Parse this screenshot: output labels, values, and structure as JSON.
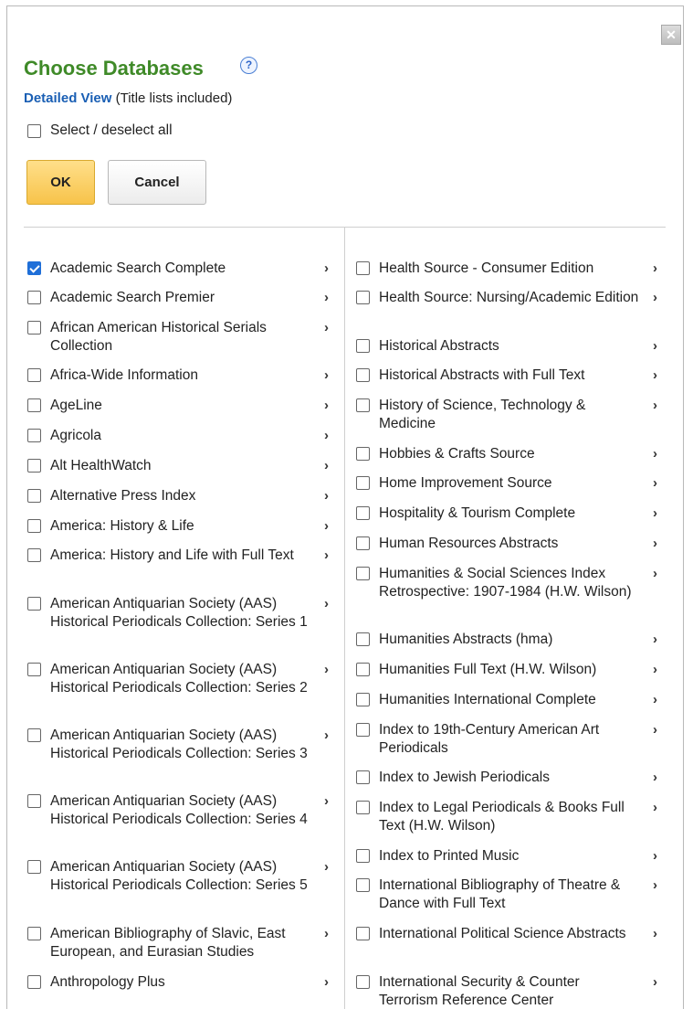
{
  "dialog": {
    "close_label": "✕",
    "title": "Choose Databases",
    "help_label": "?",
    "detailed_link": "Detailed View",
    "detailed_note": " (Title lists included)",
    "select_all_label": "Select / deselect all",
    "ok_label": "OK",
    "cancel_label": "Cancel",
    "chevron": "›"
  },
  "left_list": [
    {
      "label": "Academic Search Complete",
      "checked": true
    },
    {
      "label": "Academic Search Premier",
      "checked": false
    },
    {
      "label": "African American Historical Serials Collection",
      "checked": false
    },
    {
      "label": "Africa-Wide Information",
      "checked": false
    },
    {
      "label": "AgeLine",
      "checked": false
    },
    {
      "label": "Agricola",
      "checked": false
    },
    {
      "label": "Alt HealthWatch",
      "checked": false
    },
    {
      "label": "Alternative Press Index",
      "checked": false
    },
    {
      "label": "America: History & Life",
      "checked": false
    },
    {
      "label": "America: History and Life with Full Text",
      "checked": false
    },
    {
      "label": "American Antiquarian Society (AAS) Historical Periodicals Collection: Series 1",
      "checked": false
    },
    {
      "label": "American Antiquarian Society (AAS) Historical Periodicals Collection: Series 2",
      "checked": false
    },
    {
      "label": "American Antiquarian Society (AAS) Historical Periodicals Collection: Series 3",
      "checked": false
    },
    {
      "label": "American Antiquarian Society (AAS) Historical Periodicals Collection: Series 4",
      "checked": false
    },
    {
      "label": "American Antiquarian Society (AAS) Historical Periodicals Collection: Series 5",
      "checked": false
    },
    {
      "label": "American Bibliography of Slavic, East European, and Eurasian Studies",
      "checked": false
    },
    {
      "label": "Anthropology Plus",
      "checked": false
    }
  ],
  "right_list": [
    {
      "label": "Health Source - Consumer Edition",
      "checked": false
    },
    {
      "label": "Health Source: Nursing/Academic Edition",
      "checked": false
    },
    {
      "label": "Historical Abstracts",
      "checked": false
    },
    {
      "label": "Historical Abstracts with Full Text",
      "checked": false
    },
    {
      "label": "History of Science, Technology & Medicine",
      "checked": false
    },
    {
      "label": "Hobbies & Crafts Source",
      "checked": false
    },
    {
      "label": "Home Improvement Source",
      "checked": false
    },
    {
      "label": "Hospitality & Tourism Complete",
      "checked": false
    },
    {
      "label": "Human Resources Abstracts",
      "checked": false
    },
    {
      "label": "Humanities & Social Sciences Index Retrospective: 1907-1984 (H.W. Wilson)",
      "checked": false
    },
    {
      "label": "Humanities Abstracts (hma)",
      "checked": false
    },
    {
      "label": "Humanities Full Text (H.W. Wilson)",
      "checked": false
    },
    {
      "label": "Humanities International Complete",
      "checked": false
    },
    {
      "label": "Index to 19th-Century American Art Periodicals",
      "checked": false
    },
    {
      "label": "Index to Jewish Periodicals",
      "checked": false
    },
    {
      "label": "Index to Legal Periodicals & Books Full Text (H.W. Wilson)",
      "checked": false
    },
    {
      "label": "Index to Printed Music",
      "checked": false
    },
    {
      "label": "International Bibliography of Theatre & Dance with Full Text",
      "checked": false
    },
    {
      "label": "International Political Science Abstracts",
      "checked": false
    },
    {
      "label": "International Security & Counter Terrorism Reference Center",
      "checked": false
    }
  ]
}
